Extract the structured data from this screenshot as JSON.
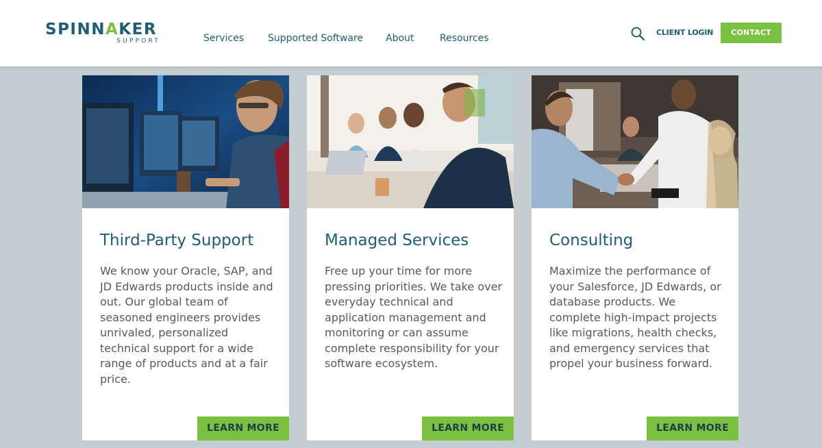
{
  "brand": {
    "logo_prefix": "SPINN",
    "logo_accent": "A",
    "logo_suffix": "KER",
    "logo_sub": "SUPPORT",
    "primary_color": "#1e5d75",
    "accent_color": "#7cc242"
  },
  "nav": {
    "items": [
      {
        "label": "Services"
      },
      {
        "label": "Supported Software"
      },
      {
        "label": "About"
      },
      {
        "label": "Resources"
      }
    ],
    "search_icon": "search-icon",
    "client_login": "CLIENT LOGIN",
    "contact": "CONTACT"
  },
  "cards": [
    {
      "title": "Third-Party Support",
      "body": "We know your Oracle, SAP, and JD Edwards products inside and out. Our global team of seasoned engineers provides unrivaled, personalized technical support for a wide range of products and at a fair price.",
      "button": "LEARN MORE",
      "image": "engineer-at-monitors-photo"
    },
    {
      "title": "Managed Services",
      "body": "Free up your time for more pressing priorities. We take over everyday technical and application management and monitoring or can assume complete responsibility for your software ecosystem.",
      "button": "LEARN MORE",
      "image": "team-meeting-photo"
    },
    {
      "title": "Consulting",
      "body": "Maximize the performance of your Salesforce, JD Edwards, or database products. We complete high-impact projects like migrations, health checks, and emergency services that propel your business forward.",
      "button": "LEARN MORE",
      "image": "handshake-meeting-photo"
    }
  ]
}
